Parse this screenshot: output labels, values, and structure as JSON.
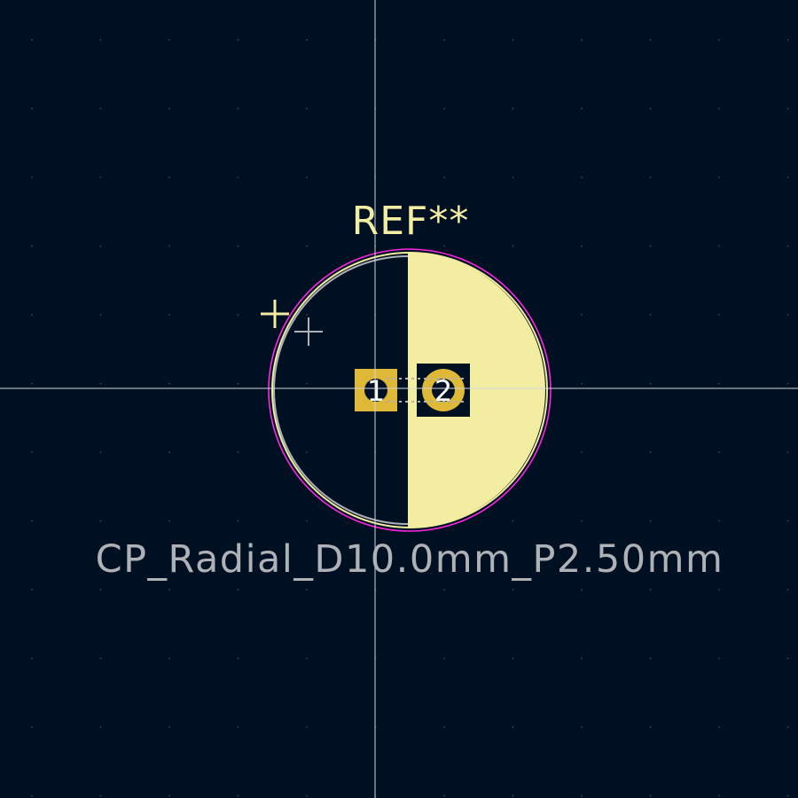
{
  "footprint": {
    "reference": "REF**",
    "value": "CP_Radial_D10.0mm_P2.50mm"
  },
  "pads": [
    {
      "number": "1",
      "shape": "square"
    },
    {
      "number": "2",
      "shape": "circle"
    }
  ],
  "colors": {
    "background": "#001023",
    "grid_dot": "#3a4a5e",
    "crosshair": "#cfd6de",
    "silkscreen": "#f2eda1",
    "fab_layer": "#aeb1b5",
    "courtyard": "#ff26e2",
    "pad_copper": "#e0b838",
    "pad_hole": "#001023",
    "pad_label": "#ffffff"
  },
  "icons": [
    "anchor-cross-icon",
    "polarity-plus-icon",
    "crosshair-cursor-icon"
  ]
}
